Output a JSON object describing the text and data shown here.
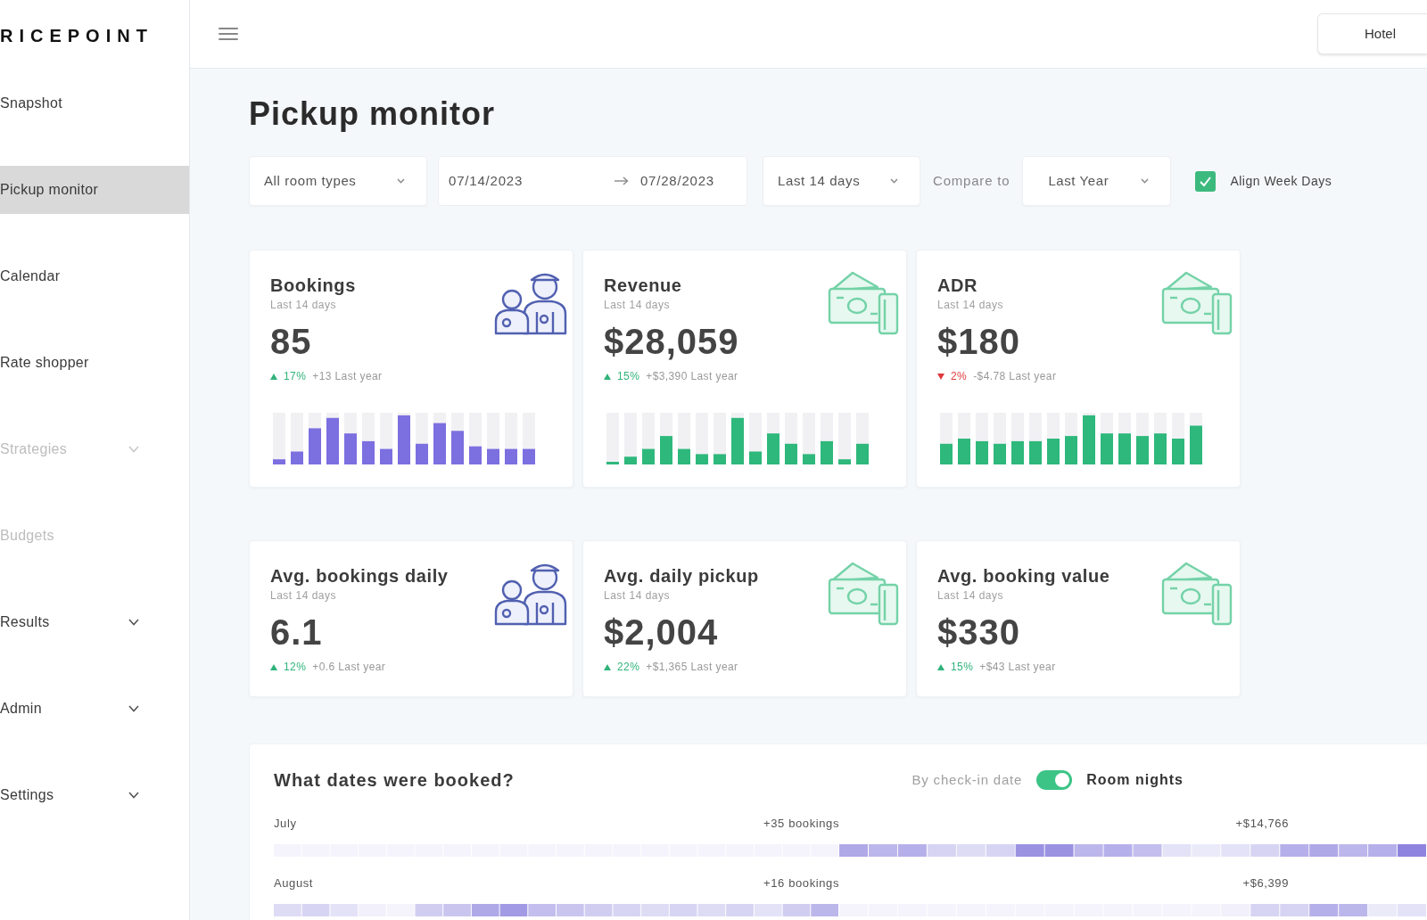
{
  "sidebar": {
    "logo": "RICEPOINT",
    "items": [
      {
        "label": "Snapshot",
        "selected": false,
        "disabled": false,
        "has_submenu": false
      },
      {
        "label": "Pickup monitor",
        "selected": true,
        "disabled": false,
        "has_submenu": false
      },
      {
        "label": "Calendar",
        "selected": false,
        "disabled": false,
        "has_submenu": false
      },
      {
        "label": "Rate shopper",
        "selected": false,
        "disabled": false,
        "has_submenu": false
      },
      {
        "label": "Strategies",
        "selected": false,
        "disabled": true,
        "has_submenu": true
      },
      {
        "label": "Budgets",
        "selected": false,
        "disabled": true,
        "has_submenu": false
      },
      {
        "label": "Results",
        "selected": false,
        "disabled": false,
        "has_submenu": true
      },
      {
        "label": "Admin",
        "selected": false,
        "disabled": false,
        "has_submenu": true
      },
      {
        "label": "Settings",
        "selected": false,
        "disabled": false,
        "has_submenu": true
      }
    ]
  },
  "header": {
    "property_button": "Hotel"
  },
  "page": {
    "title": "Pickup monitor"
  },
  "filters": {
    "room_type": "All room types",
    "date_from": "07/14/2023",
    "date_to": "07/28/2023",
    "period": "Last 14 days",
    "compare_label": "Compare to",
    "compare_value": "Last Year",
    "align_week_days": {
      "label": "Align Week Days",
      "checked": true
    }
  },
  "kpi_cards": [
    {
      "kind": "people",
      "title": "Bookings",
      "subtitle": "Last 14 days",
      "value": "85",
      "increase": true,
      "change": "17%",
      "comparison": "+13 Last year",
      "sparkline": true
    },
    {
      "kind": "money",
      "title": "Revenue",
      "subtitle": "Last 14 days",
      "value": "$28,059",
      "increase": true,
      "change": "15%",
      "comparison": "+$3,390 Last year",
      "sparkline": true
    },
    {
      "kind": "money",
      "title": "ADR",
      "subtitle": "Last 14 days",
      "value": "$180",
      "increase": false,
      "change": "2%",
      "comparison": "-$4.78 Last year",
      "sparkline": true
    },
    {
      "kind": "people",
      "title": "Avg. bookings daily",
      "subtitle": "Last 14 days",
      "value": "6.1",
      "increase": true,
      "change": "12%",
      "comparison": "+0.6 Last year",
      "sparkline": false
    },
    {
      "kind": "money",
      "title": "Avg. daily pickup",
      "subtitle": "Last 14 days",
      "value": "$2,004",
      "increase": true,
      "change": "22%",
      "comparison": "+$1,365 Last year",
      "sparkline": false
    },
    {
      "kind": "money",
      "title": "Avg. booking value",
      "subtitle": "Last 14 days",
      "value": "$330",
      "increase": true,
      "change": "15%",
      "comparison": "+$43 Last year",
      "sparkline": false
    }
  ],
  "booked_dates": {
    "title": "What dates were booked?",
    "toggle": {
      "left_label": "By check-in date",
      "right_label": "Room nights",
      "on": true
    },
    "months": [
      {
        "label": "July",
        "bookings": "+35 bookings",
        "revenue": "+$14,766"
      },
      {
        "label": "August",
        "bookings": "+16 bookings",
        "revenue": "+$6,399"
      }
    ]
  }
}
